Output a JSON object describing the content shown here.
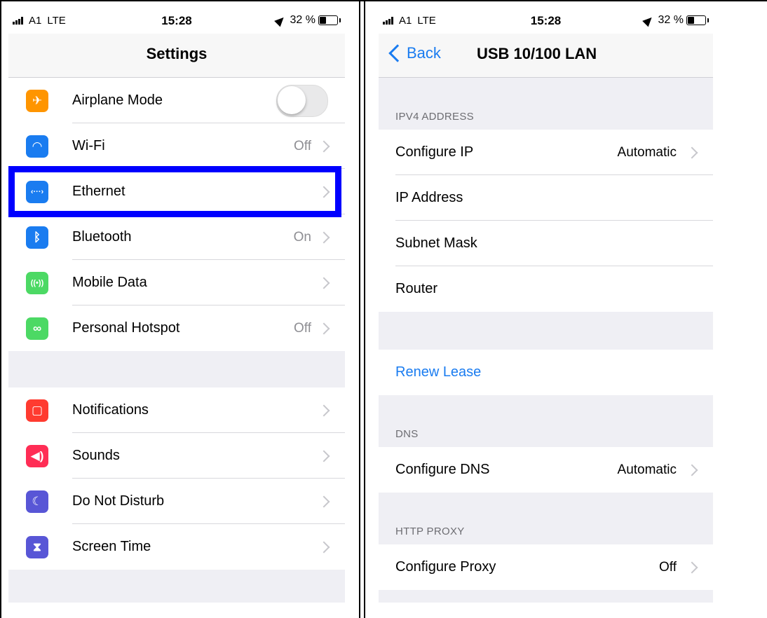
{
  "statusbar": {
    "carrier": "A1",
    "network": "LTE",
    "time": "15:28",
    "battery": "32 %"
  },
  "left": {
    "title": "Settings",
    "group1": [
      {
        "label": "Airplane Mode",
        "value": "",
        "icon": "airplane-icon",
        "color": "#ff9500",
        "glyph": "✈"
      },
      {
        "label": "Wi-Fi",
        "value": "Off",
        "icon": "wifi-icon",
        "color": "#1a7cf0",
        "glyph": "◠"
      },
      {
        "label": "Ethernet",
        "value": "",
        "icon": "ethernet-icon",
        "color": "#1a7cf0",
        "glyph": "‹···›"
      },
      {
        "label": "Bluetooth",
        "value": "On",
        "icon": "bluetooth-icon",
        "color": "#1a7cf0",
        "glyph": "ᛒ"
      },
      {
        "label": "Mobile Data",
        "value": "",
        "icon": "antenna-icon",
        "color": "#4cd964",
        "glyph": "((•))"
      },
      {
        "label": "Personal Hotspot",
        "value": "Off",
        "icon": "hotspot-icon",
        "color": "#4cd964",
        "glyph": "∞"
      }
    ],
    "group2": [
      {
        "label": "Notifications",
        "value": "",
        "icon": "notifications-icon",
        "color": "#ff3b30",
        "glyph": "▢"
      },
      {
        "label": "Sounds",
        "value": "",
        "icon": "speaker-icon",
        "color": "#ff2d55",
        "glyph": "◀)"
      },
      {
        "label": "Do Not Disturb",
        "value": "",
        "icon": "moon-icon",
        "color": "#5856d6",
        "glyph": "☾"
      },
      {
        "label": "Screen Time",
        "value": "",
        "icon": "hourglass-icon",
        "color": "#5856d6",
        "glyph": "⧗"
      }
    ]
  },
  "right": {
    "back": "Back",
    "title": "USB 10/100 LAN",
    "ipv4_header": "IPV4 ADDRESS",
    "ipv4": [
      {
        "label": "Configure IP",
        "value": "Automatic"
      },
      {
        "label": "IP Address",
        "value": ""
      },
      {
        "label": "Subnet Mask",
        "value": ""
      },
      {
        "label": "Router",
        "value": ""
      }
    ],
    "renew": "Renew Lease",
    "dns_header": "DNS",
    "dns": {
      "label": "Configure DNS",
      "value": "Automatic"
    },
    "proxy_header": "HTTP PROXY",
    "proxy": {
      "label": "Configure Proxy",
      "value": "Off"
    }
  }
}
